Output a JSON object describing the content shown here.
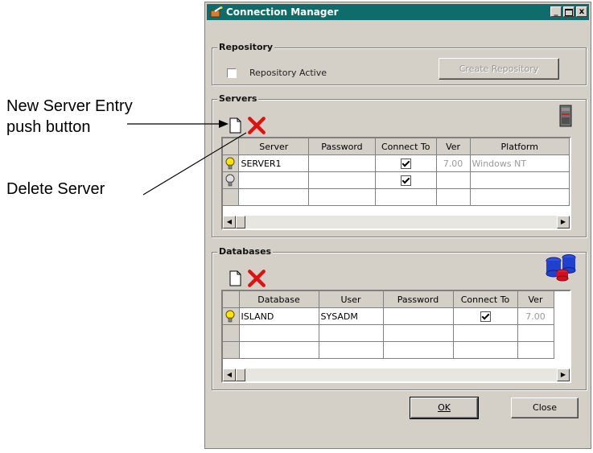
{
  "callouts": {
    "new_server_line1": "New Server Entry",
    "new_server_line2": "push button",
    "delete_server": "Delete Server"
  },
  "window": {
    "title": "Connection Manager",
    "minimize_glyph": "_",
    "close_glyph": "x"
  },
  "repository": {
    "group_label": "Repository",
    "checkbox_label": "Repository Active",
    "create_button": "Create Repository"
  },
  "servers": {
    "group_label": "Servers",
    "columns": [
      "Server",
      "Password",
      "Connect To",
      "Ver",
      "Platform"
    ],
    "rows": [
      {
        "server": "SERVER1",
        "password": "",
        "connect": true,
        "ver": "7.00",
        "platform": "Windows NT"
      },
      {
        "server": "",
        "password": "",
        "connect": true,
        "ver": "",
        "platform": ""
      }
    ]
  },
  "databases": {
    "group_label": "Databases",
    "columns": [
      "Database",
      "User",
      "Password",
      "Connect To",
      "Ver"
    ],
    "rows": [
      {
        "database": "ISLAND",
        "user": "SYSADM",
        "password": "",
        "connect": true,
        "ver": "7.00"
      }
    ]
  },
  "buttons": {
    "ok_label": "OK",
    "close_label": "Close"
  },
  "icons": {
    "new_entry": "new-document-icon",
    "delete": "red-x-delete-icon",
    "server": "server-tower-icon",
    "databases": "database-cylinders-icon",
    "active_row": "yellow-lightbulb-icon",
    "inactive_row": "gray-lightbulb-icon"
  },
  "colors": {
    "titlebar": "#0e6c6a",
    "window_bg": "#d4d0c8",
    "delete_red": "#e01010"
  }
}
